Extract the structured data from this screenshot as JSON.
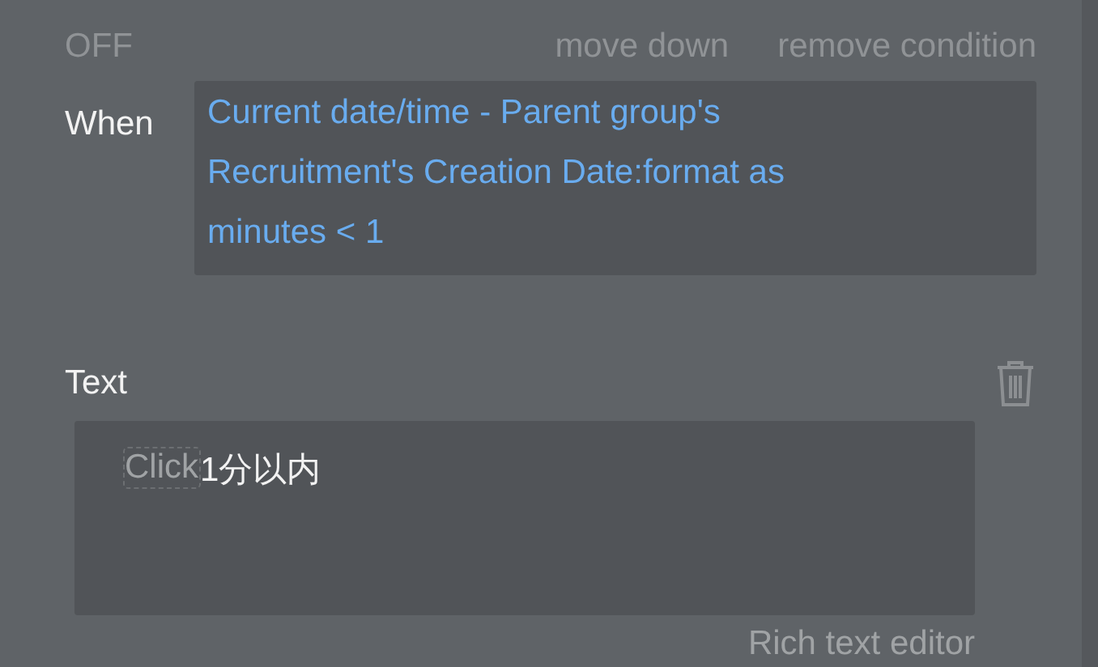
{
  "header": {
    "toggle": "OFF",
    "actions": [
      "move down",
      "remove condition"
    ]
  },
  "condition": {
    "label": "When",
    "expression": "Current date/time - Parent group's Recruitment's Creation Date:format as minutes < 1"
  },
  "property": {
    "label": "Text",
    "placeholder": "Click",
    "value": "1分以内",
    "editor_link": "Rich text editor"
  }
}
